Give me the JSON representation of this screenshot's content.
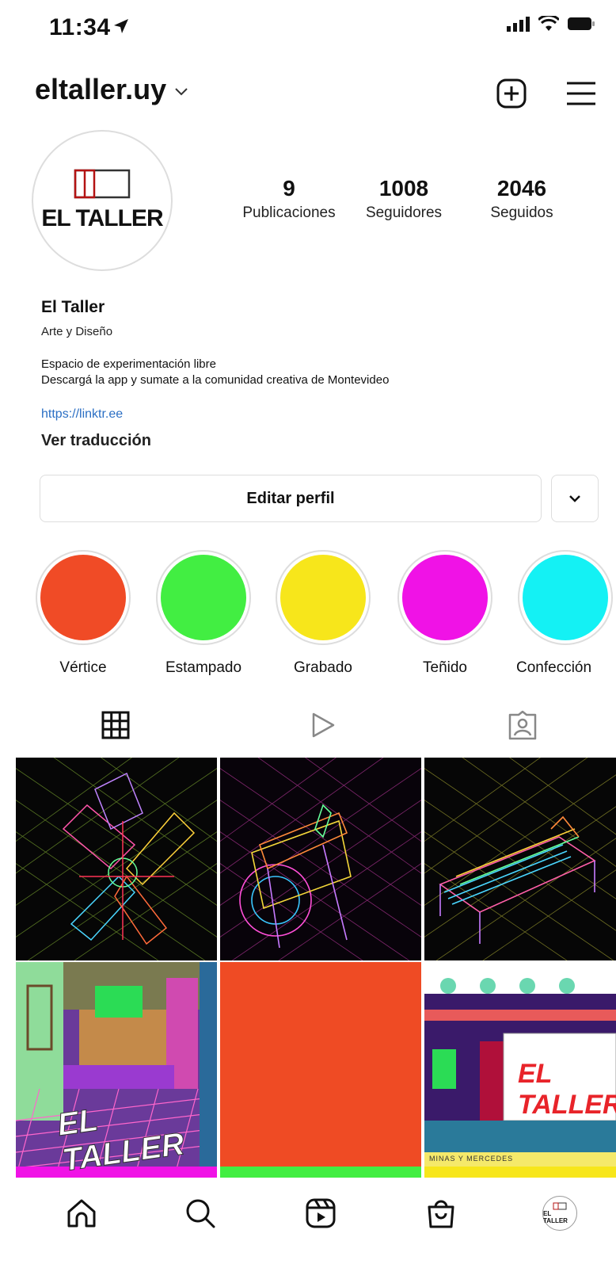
{
  "status_bar": {
    "time": "11:34"
  },
  "header": {
    "username": "eltaller.uy",
    "icons": [
      "chevron-down-icon",
      "plus-square-icon",
      "menu-icon"
    ]
  },
  "profile": {
    "avatar_text": "EL TALLER",
    "stats": [
      {
        "value": "9",
        "label": "Publicaciones"
      },
      {
        "value": "1008",
        "label": "Seguidores"
      },
      {
        "value": "2046",
        "label": "Seguidos"
      }
    ],
    "name": "El Taller",
    "category": "Arte y Diseño",
    "bio": [
      "Espacio de experimentación libre",
      "Descargá la app y sumate a la comunidad creativa de Montevideo"
    ],
    "link": "https://linktr.ee",
    "translate": "Ver traducción",
    "edit_button": "Editar perfil"
  },
  "highlights": [
    {
      "label": "Vértice",
      "color": "#f04b26"
    },
    {
      "label": "Estampado",
      "color": "#42ee42"
    },
    {
      "label": "Grabado",
      "color": "#f7e61b"
    },
    {
      "label": "Teñido",
      "color": "#f012e6"
    },
    {
      "label": "Confección",
      "color": "#14f1f4"
    }
  ],
  "tabs": [
    "grid-icon",
    "reels-icon",
    "tagged-icon"
  ],
  "grid": {
    "overlay_texts": [
      "EL TALLER",
      "EL TALLER",
      "MINAS Y MERCEDES"
    ],
    "bar_colors": [
      "#f012e6",
      "#42ee42",
      "#f7e61b"
    ]
  },
  "bottom_nav": {
    "avatar_text": "EL TALLER"
  }
}
